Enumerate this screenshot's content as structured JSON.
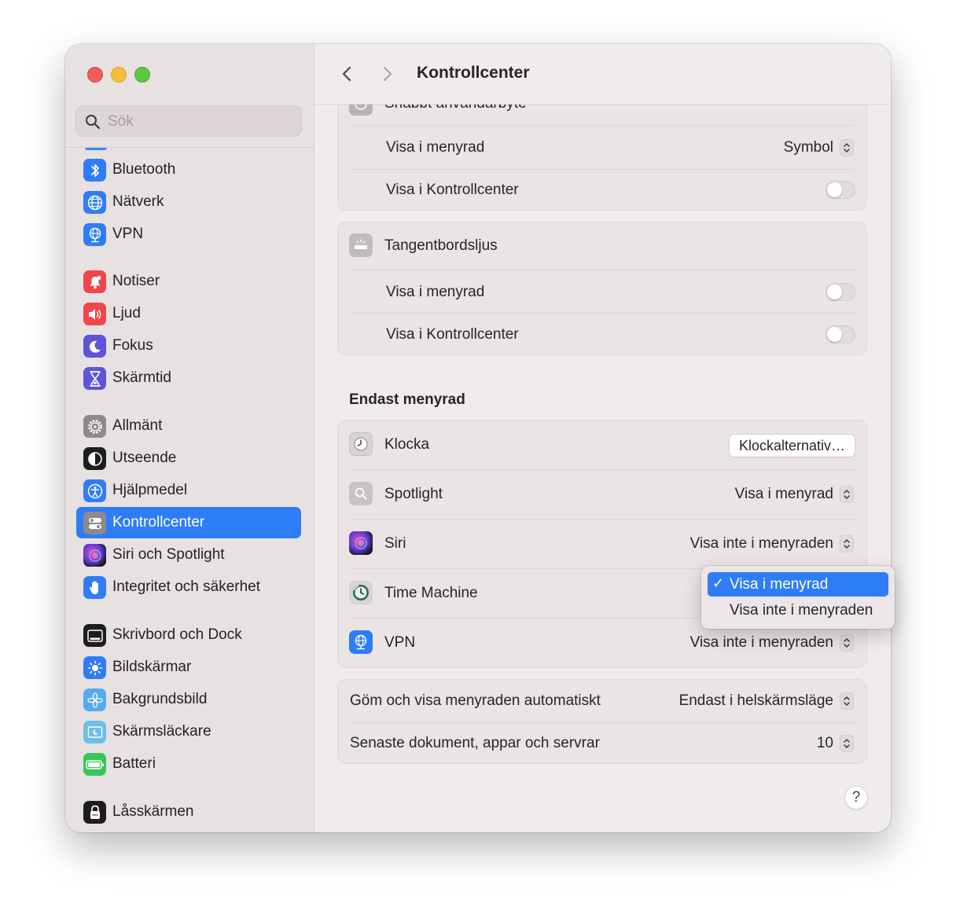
{
  "window": {
    "title": "Kontrollcenter"
  },
  "search": {
    "placeholder": "Sök"
  },
  "sidebar": {
    "items": [
      {
        "label": "Bluetooth",
        "icon": "bluetooth-icon",
        "color": "#2f7df6"
      },
      {
        "label": "Nätverk",
        "icon": "globe-icon",
        "color": "#2f7df6"
      },
      {
        "label": "VPN",
        "icon": "vpn-globe-icon",
        "color": "#2f7df6"
      },
      {
        "label": "Notiser",
        "icon": "bell-icon",
        "color": "#f0454b"
      },
      {
        "label": "Ljud",
        "icon": "speaker-icon",
        "color": "#f0454b"
      },
      {
        "label": "Fokus",
        "icon": "moon-icon",
        "color": "#5f53d9"
      },
      {
        "label": "Skärmtid",
        "icon": "hourglass-icon",
        "color": "#5f53d9"
      },
      {
        "label": "Allmänt",
        "icon": "gear-icon",
        "color": "#8e8a8b"
      },
      {
        "label": "Utseende",
        "icon": "appearance-icon",
        "color": "#1d1d1d"
      },
      {
        "label": "Hjälpmedel",
        "icon": "accessibility-icon",
        "color": "#2f7df6"
      },
      {
        "label": "Kontrollcenter",
        "icon": "control-center-icon",
        "color": "#8e8a8b",
        "selected": true
      },
      {
        "label": "Siri och Spotlight",
        "icon": "siri-icon",
        "color": "#5a2e9e"
      },
      {
        "label": "Integritet och säkerhet",
        "icon": "hand-icon",
        "color": "#2f7df6"
      },
      {
        "label": "Skrivbord och Dock",
        "icon": "dock-icon",
        "color": "#1d1d1d"
      },
      {
        "label": "Bildskärmar",
        "icon": "sun-icon",
        "color": "#2f7df6"
      },
      {
        "label": "Bakgrundsbild",
        "icon": "flower-icon",
        "color": "#55aaf0"
      },
      {
        "label": "Skärmsläckare",
        "icon": "screensaver-icon",
        "color": "#6cc0e8"
      },
      {
        "label": "Batteri",
        "icon": "battery-icon",
        "color": "#35c759"
      },
      {
        "label": "Låsskärmen",
        "icon": "lock-icon",
        "color": "#1d1d1d"
      }
    ]
  },
  "groups": {
    "fast_user": {
      "partial_title": "Snabbt användarbyte",
      "rows": [
        {
          "label": "Visa i menyrad",
          "value": "Symbol"
        },
        {
          "label": "Visa i Kontrollcenter",
          "toggle": false
        }
      ]
    },
    "keyboard_light": {
      "title": "Tangentbordsljus",
      "rows": [
        {
          "label": "Visa i menyrad",
          "toggle": false
        },
        {
          "label": "Visa i Kontrollcenter",
          "toggle": false
        }
      ]
    }
  },
  "menubar_only": {
    "title": "Endast menyrad",
    "rows": [
      {
        "label": "Klocka",
        "button": "Klockalternativ…"
      },
      {
        "label": "Spotlight",
        "value": "Visa i menyrad"
      },
      {
        "label": "Siri",
        "value": "Visa inte i menyraden"
      },
      {
        "label": "Time Machine",
        "value": "Visa i menyrad"
      },
      {
        "label": "VPN",
        "value": "Visa inte i menyraden"
      }
    ]
  },
  "menubar_settings": {
    "rows": [
      {
        "label": "Göm och visa menyraden automatiskt",
        "value": "Endast i helskärmsläge"
      },
      {
        "label": "Senaste dokument, appar och servrar",
        "value": "10"
      }
    ]
  },
  "dropdown": {
    "options": [
      {
        "label": "Visa i menyrad",
        "checked": true,
        "check": "✓"
      },
      {
        "label": "Visa inte i menyraden",
        "checked": false
      }
    ]
  },
  "help": {
    "label": "?"
  },
  "colors": {
    "accent": "#2f7df6",
    "sidebar_bg": "#e8e1e2",
    "content_bg": "#f1ecec"
  }
}
